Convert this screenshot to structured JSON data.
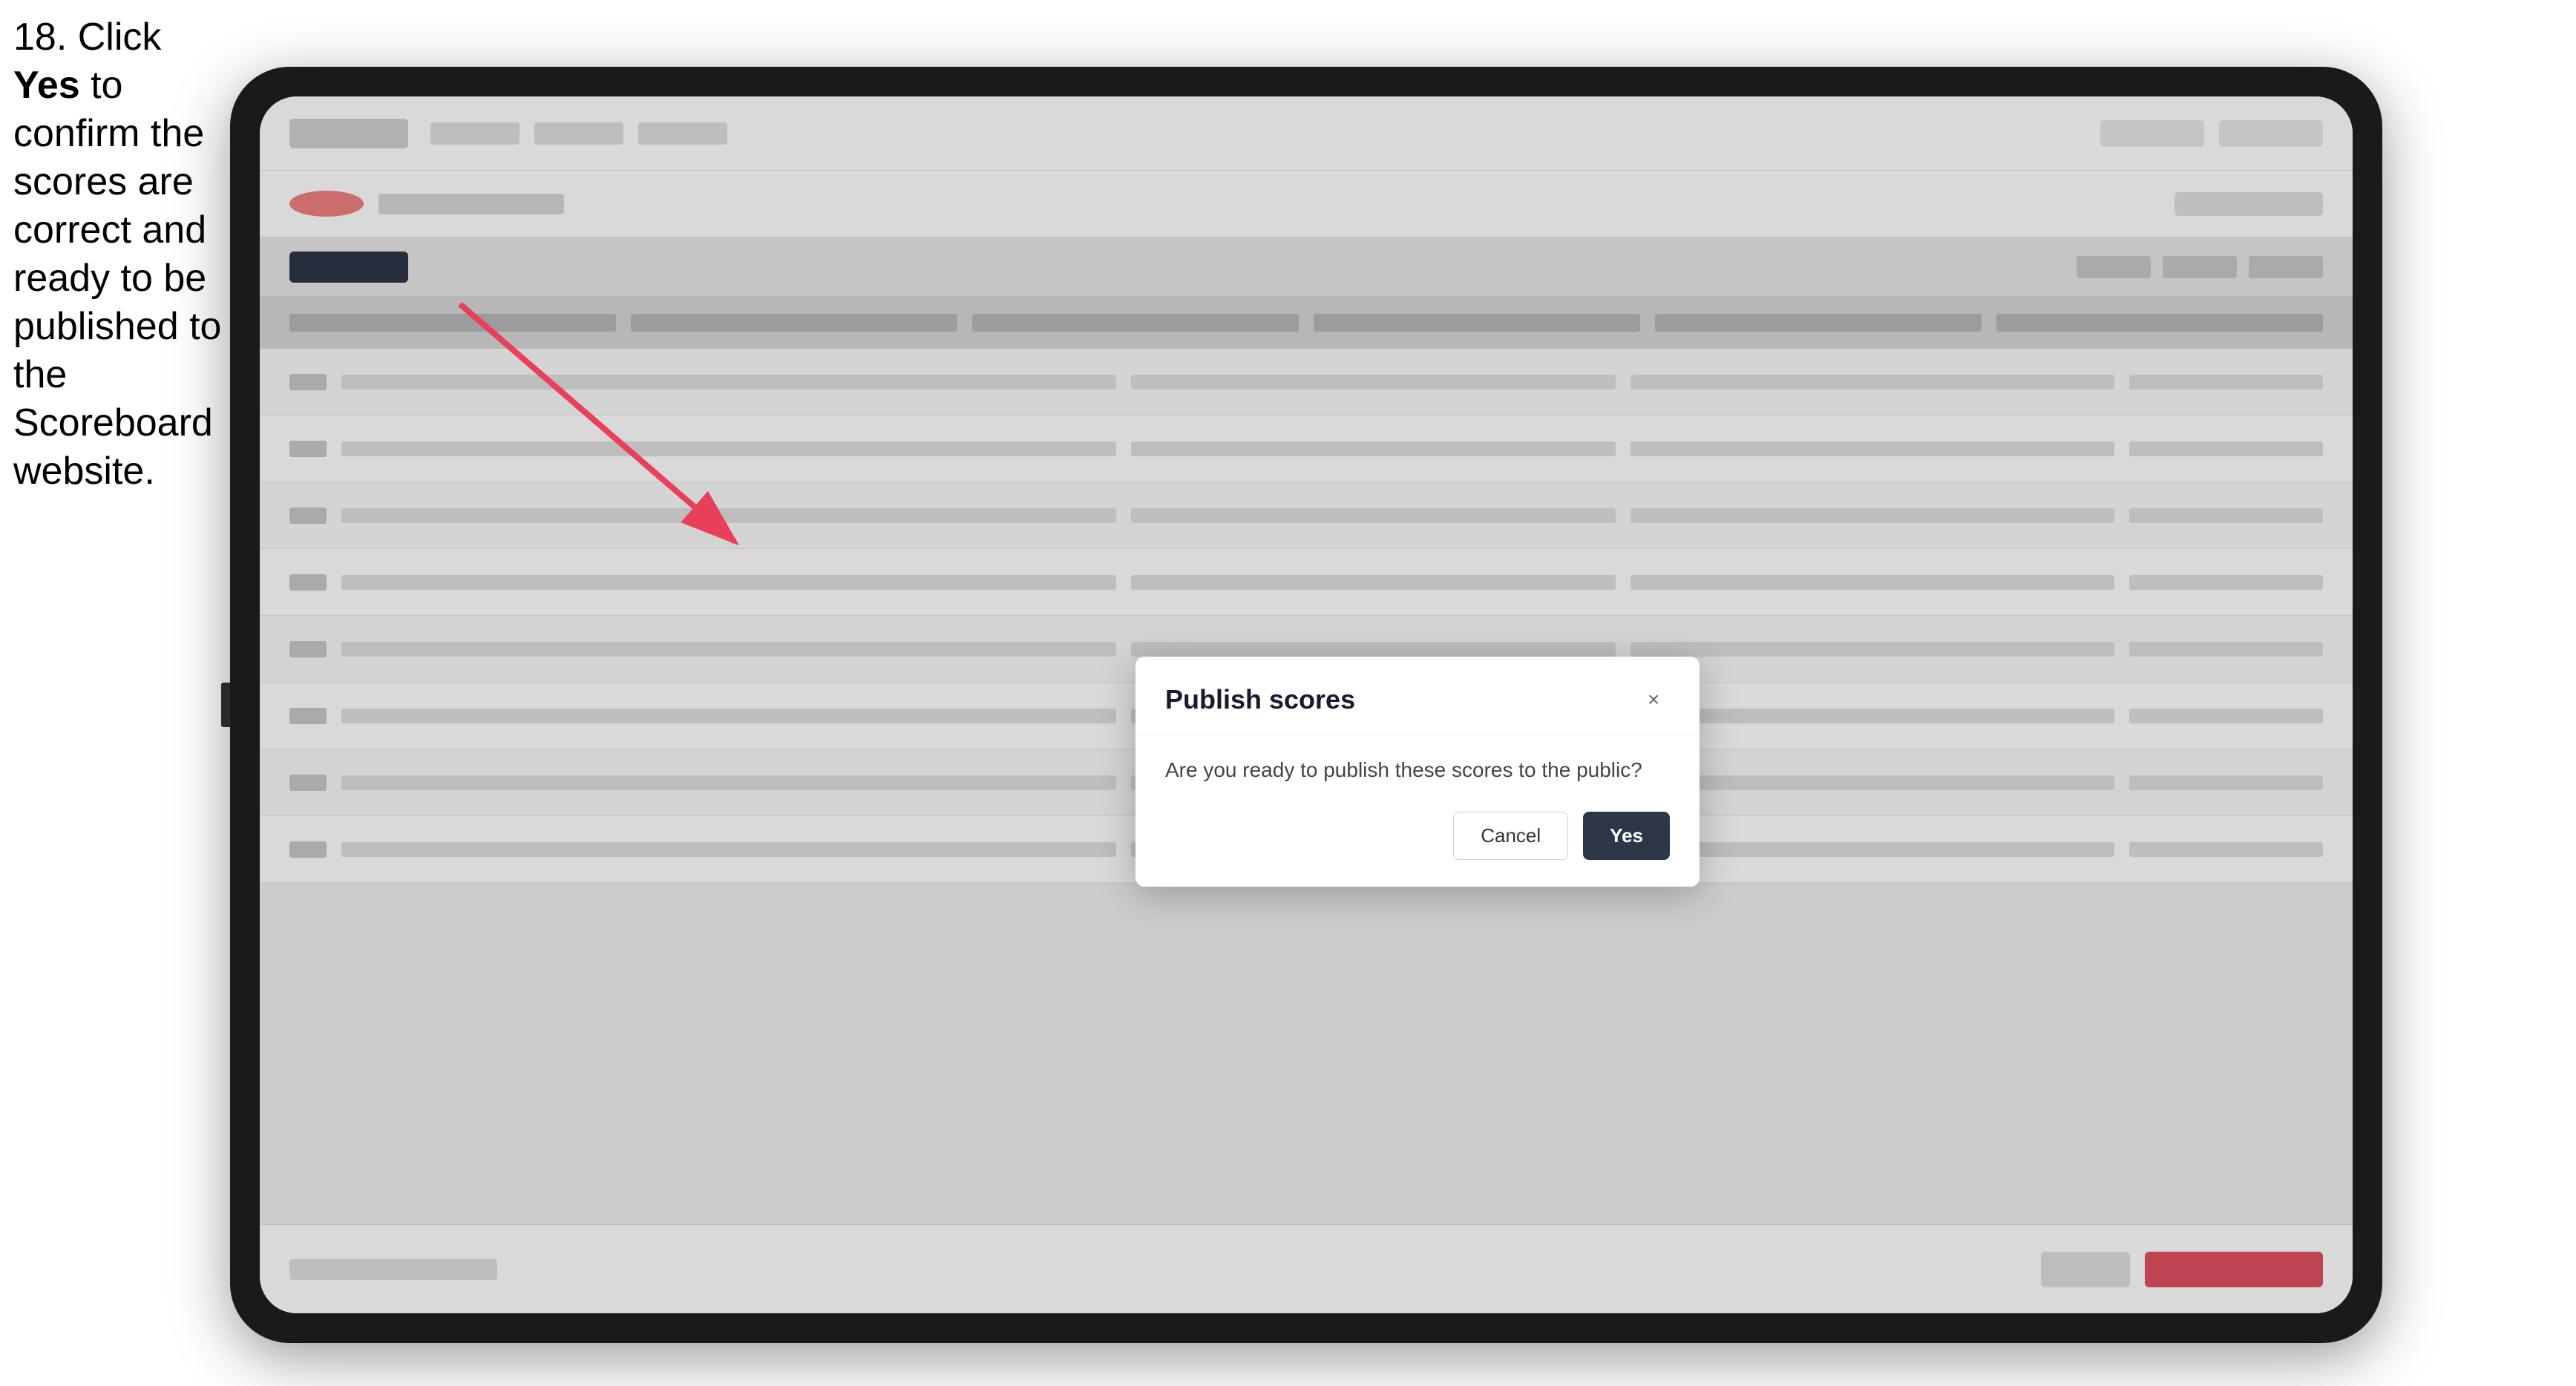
{
  "instruction": {
    "number": "18.",
    "text_part1": " Click ",
    "bold_text": "Yes",
    "text_part2": " to confirm the scores are correct and ready to be published to the Scoreboard website."
  },
  "modal": {
    "title": "Publish scores",
    "message": "Are you ready to publish these scores to the public?",
    "cancel_label": "Cancel",
    "yes_label": "Yes",
    "close_icon": "×"
  },
  "app": {
    "table_rows": [
      {
        "cells": 5
      },
      {
        "cells": 5
      },
      {
        "cells": 5
      },
      {
        "cells": 5
      },
      {
        "cells": 5
      },
      {
        "cells": 5
      },
      {
        "cells": 5
      },
      {
        "cells": 5
      },
      {
        "cells": 5
      }
    ]
  }
}
